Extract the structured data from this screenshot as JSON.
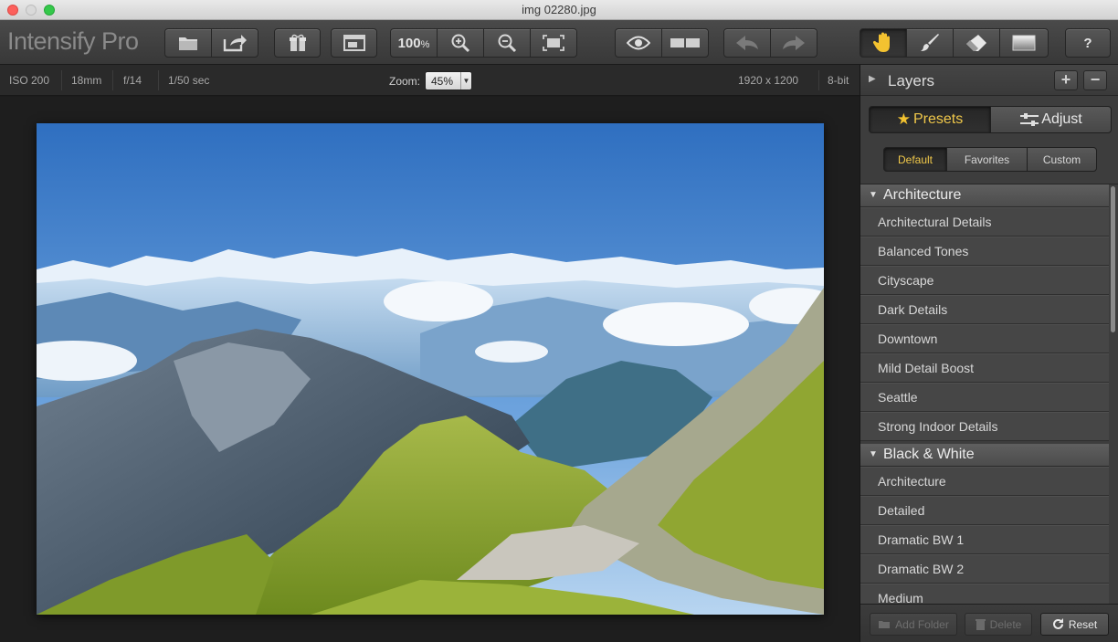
{
  "window": {
    "title": "img 02280.jpg"
  },
  "app": {
    "name": "Intensify Pro"
  },
  "toolbar": {
    "zoom_100_label": "100",
    "zoom_100_unit": "%",
    "help_label": "?",
    "icons": [
      "open-folder-icon",
      "share-icon",
      "gift-icon",
      "window-icon",
      "zoom-in-icon",
      "zoom-out-icon",
      "fit-screen-icon",
      "eye-icon",
      "split-view-icon",
      "undo-icon",
      "redo-icon",
      "hand-icon",
      "brush-icon",
      "eraser-icon",
      "gradient-icon",
      "help-icon"
    ]
  },
  "infobar": {
    "iso": "ISO 200",
    "focal": "18mm",
    "aperture": "f/14",
    "shutter": "1/50 sec",
    "zoom_label": "Zoom:",
    "zoom_value": "45%",
    "dimensions": "1920 x 1200",
    "bit_depth": "8-bit"
  },
  "panel": {
    "layers_title": "Layers",
    "add_label": "+",
    "remove_label": "−",
    "tabs": {
      "presets": "Presets",
      "adjust": "Adjust"
    },
    "subtabs": {
      "default": "Default",
      "favorites": "Favorites",
      "custom": "Custom"
    },
    "categories": [
      {
        "name": "Architecture",
        "items": [
          "Architectural Details",
          "Balanced Tones",
          "Cityscape",
          "Dark Details",
          "Downtown",
          "Mild Detail Boost",
          "Seattle",
          "Strong Indoor Details"
        ]
      },
      {
        "name": "Black & White",
        "items": [
          "Architecture",
          "Detailed",
          "Dramatic BW 1",
          "Dramatic BW 2",
          "Medium"
        ]
      }
    ],
    "bottom": {
      "add_folder": "Add Folder",
      "delete": "Delete",
      "reset": "Reset"
    }
  },
  "colors": {
    "accent": "#f0c84a",
    "toolbar": "#404040",
    "panel": "#3d3d3d",
    "sky_top": "#2d6fbf",
    "grass": "#8fae2e"
  }
}
